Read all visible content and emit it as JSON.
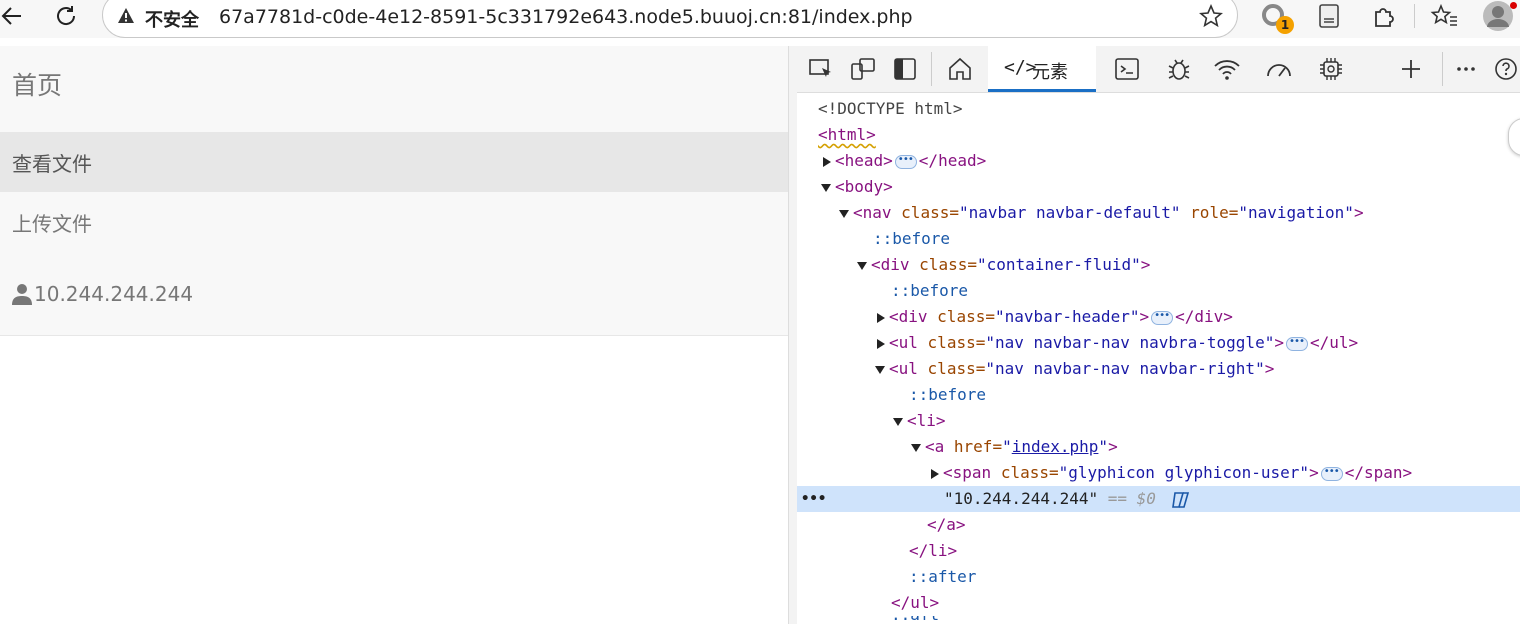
{
  "browser": {
    "security_label": "不安全",
    "url": "67a7781d-c0de-4e12-8591-5c331792e643.node5.buuoj.cn:81/index.php",
    "extension_badge": "1"
  },
  "page": {
    "brand": "首页",
    "nav_items": [
      {
        "label": "查看文件",
        "active": true
      },
      {
        "label": "上传文件",
        "active": false
      }
    ],
    "user_ip": "10.244.244.244"
  },
  "devtools": {
    "active_tab": {
      "code": "</>",
      "label": "元素"
    },
    "dom_lines": {
      "doctype": "<!DOCTYPE html>",
      "html_open": "<html>",
      "head_open": "<head>",
      "head_close": "</head>",
      "body_open": "<body>",
      "nav_tag": "<nav",
      "nav_class_attr": "class=",
      "nav_class_val": "\"navbar navbar-default\"",
      "nav_role_attr": "role=",
      "nav_role_val": "\"navigation\"",
      "gt": ">",
      "before": "::before",
      "after": "::after",
      "div_tag": "<div",
      "class_attr": "class=",
      "container_val": "\"container-fluid\"",
      "header_val": "\"navbar-header\"",
      "div_close": "</div>",
      "ul_tag": "<ul",
      "toggle_val": "\"nav navbar-nav navbra-toggle\"",
      "ul_close": "</ul>",
      "right_val": "\"nav navbar-nav navbar-right\"",
      "li_open": "<li>",
      "a_tag": "<a",
      "href_attr": "href=",
      "quote": "\"",
      "href_val": "index.php",
      "span_tag": "<span",
      "span_val": "\"glyphicon glyphicon-user\"",
      "span_close": "</span>",
      "text_node": "\"10.244.244.244\"",
      "selected_marker": "== $0",
      "a_close": "</a>",
      "li_close": "</li>",
      "partial": "::aft"
    }
  }
}
